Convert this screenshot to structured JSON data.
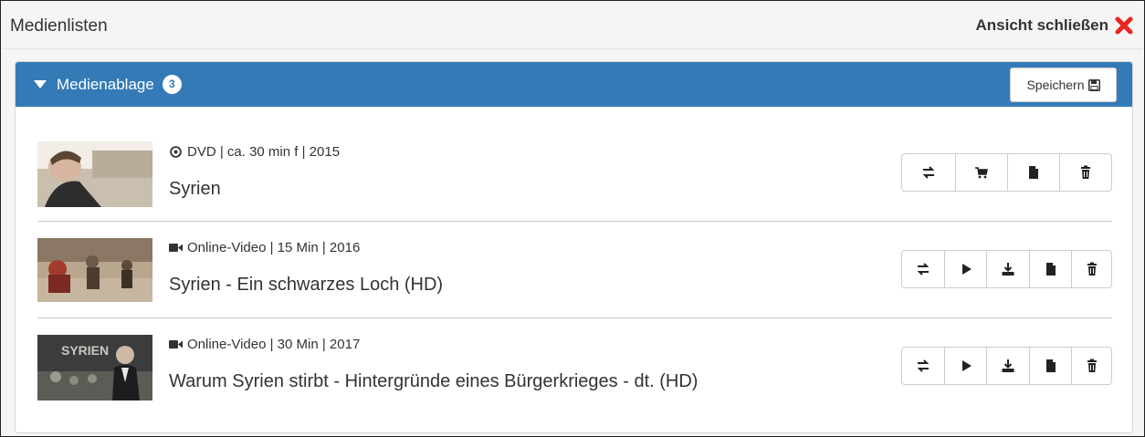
{
  "header": {
    "title": "Medienlisten",
    "close_label": "Ansicht schließen",
    "close_icon": "red-x-icon",
    "close_color": "#e8251e"
  },
  "panel": {
    "title": "Medienablage",
    "count": "3",
    "save_label": "Speichern",
    "accent": "#337ab7"
  },
  "items": [
    {
      "meta": "DVD | ca. 30 min f | 2015",
      "meta_icon": "disc-icon",
      "title": "Syrien",
      "buttons": [
        "transfer-icon",
        "cart-icon",
        "document-icon",
        "trash-icon"
      ]
    },
    {
      "meta": "Online-Video | 15 Min | 2016",
      "meta_icon": "video-camera-icon",
      "title": "Syrien - Ein schwarzes Loch (HD)",
      "buttons": [
        "transfer-icon",
        "play-icon",
        "download-icon",
        "document-icon",
        "trash-icon"
      ]
    },
    {
      "meta": "Online-Video | 30 Min | 2017",
      "meta_icon": "video-camera-icon",
      "title": "Warum Syrien stirbt - Hintergründe eines Bürgerkrieges - dt. (HD)",
      "buttons": [
        "transfer-icon",
        "play-icon",
        "download-icon",
        "document-icon",
        "trash-icon"
      ]
    }
  ]
}
